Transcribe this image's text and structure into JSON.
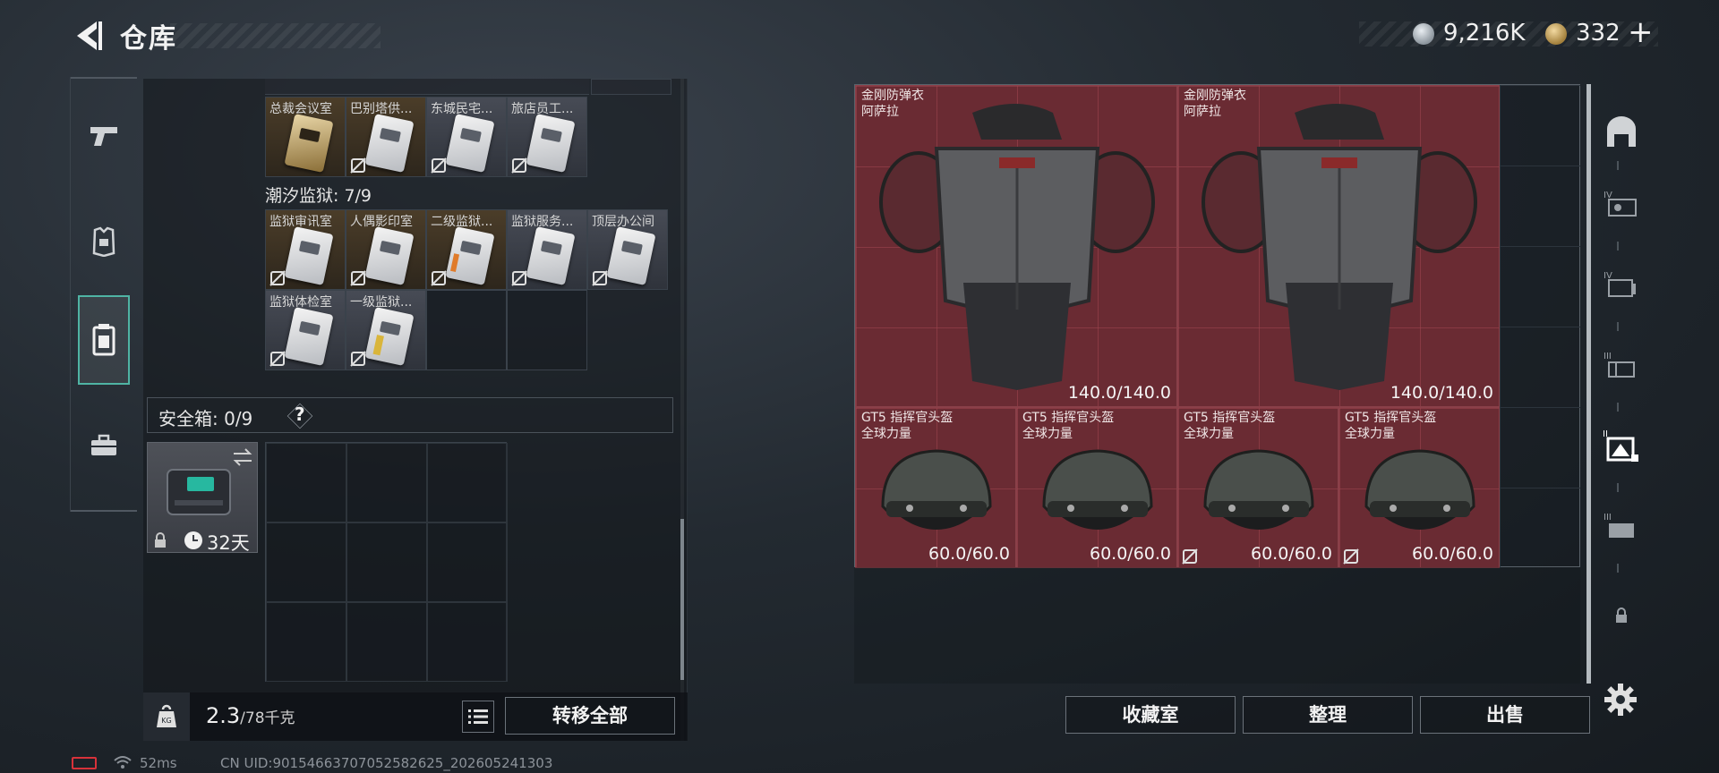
{
  "header": {
    "title": "仓库",
    "silver_amount": "9,216K",
    "gold_amount": "332",
    "plus_label": "+"
  },
  "left_nav": {
    "items": [
      {
        "icon": "pistol-icon"
      },
      {
        "icon": "armor-icon"
      },
      {
        "icon": "keycard-case-icon",
        "active": true
      },
      {
        "icon": "toolbox-icon"
      }
    ]
  },
  "keycards": {
    "row0": [
      {
        "label": "总裁会议室",
        "style": "gold"
      },
      {
        "label": "巴别塔供...",
        "style": "gold"
      },
      {
        "label": "东城民宅...",
        "style": "gray"
      },
      {
        "label": "旅店员工...",
        "style": "gray"
      }
    ],
    "prison_title": "潮汐监狱: 7/9",
    "prison_row1": [
      {
        "label": "监狱审讯室",
        "style": "gold"
      },
      {
        "label": "人偶影印室",
        "style": "gold"
      },
      {
        "label": "二级监狱...",
        "style": "gold"
      },
      {
        "label": "监狱服务...",
        "style": "gray"
      },
      {
        "label": "顶层办公间",
        "style": "gray"
      }
    ],
    "prison_row2": [
      {
        "label": "监狱体检室",
        "style": "gray"
      },
      {
        "label": "一级监狱...",
        "style": "gray"
      }
    ]
  },
  "safe": {
    "label": "安全箱: 0/9",
    "help": "?",
    "days": "32天"
  },
  "weight": {
    "current": "2.3",
    "max": "/78千克"
  },
  "buttons": {
    "transfer_all": "转移全部",
    "collection_room": "收藏室",
    "organize": "整理",
    "sell": "出售"
  },
  "stash_items": [
    {
      "name": "金刚防弹衣",
      "sub": "阿萨拉",
      "durability": "140.0/140.0"
    },
    {
      "name": "金刚防弹衣",
      "sub": "阿萨拉",
      "durability": "140.0/140.0"
    },
    {
      "name": "GT5 指挥官头盔",
      "sub": "全球力量",
      "durability": "60.0/60.0"
    },
    {
      "name": "GT5 指挥官头盔",
      "sub": "全球力量",
      "durability": "60.0/60.0"
    },
    {
      "name": "GT5 指挥官头盔",
      "sub": "全球力量",
      "durability": "60.0/60.0"
    },
    {
      "name": "GT5 指挥官头盔",
      "sub": "全球力量",
      "durability": "60.0/60.0"
    }
  ],
  "right_nav": {
    "items": [
      "hideout-icon",
      "stash-iv-a-icon",
      "stash-iv-b-icon",
      "stash-iii-a-icon",
      "stash-ii-active-icon",
      "stash-iii-b-icon",
      "lock-icon"
    ]
  },
  "status": {
    "ping": "52ms",
    "uid": "CN UID:901546637070525826​25_202605241303"
  },
  "colors": {
    "accent": "#4fb4a4",
    "stash_item_bg": "#6a2b33",
    "battery_low": "#d8323a"
  }
}
